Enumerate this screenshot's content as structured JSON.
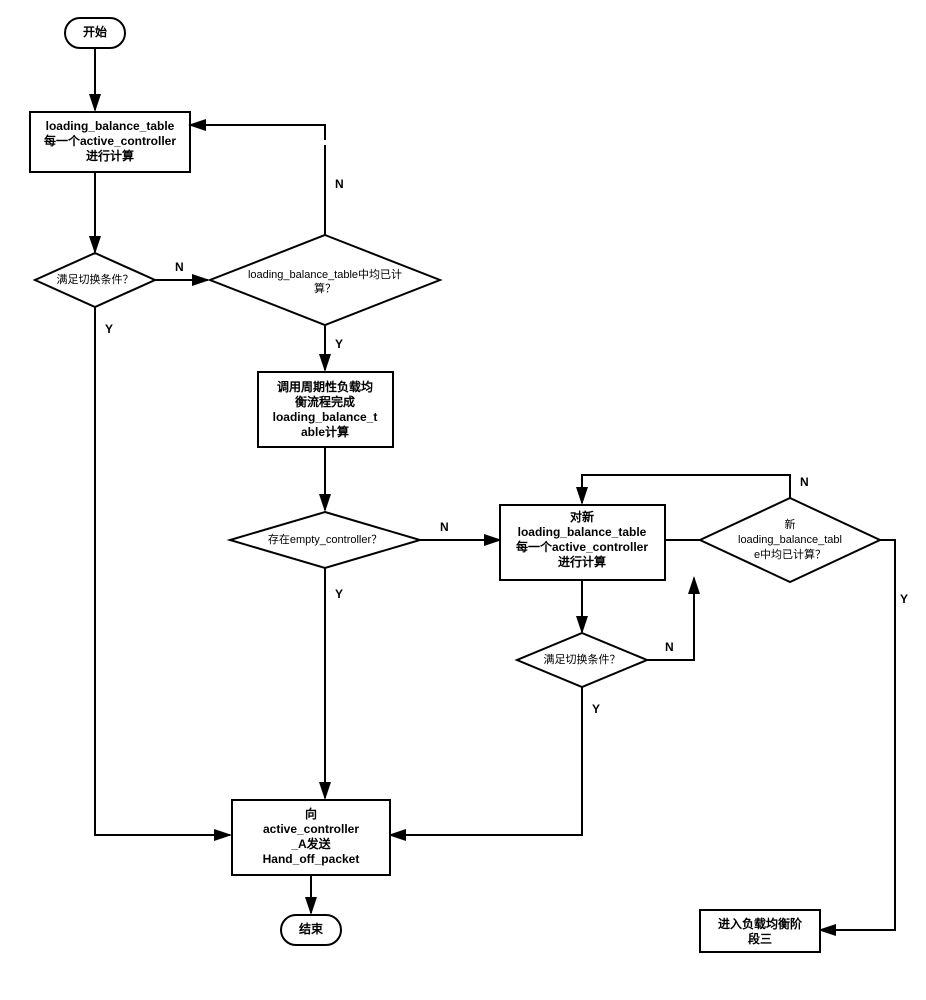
{
  "diagram": {
    "start": "开始",
    "end": "结束",
    "box1_l1": "loading_balance_table",
    "box1_l2": "每一个active_controller",
    "box1_l3": "进行计算",
    "d1": "满足切换条件？",
    "d2_l1": "loading_balance_table中均已计",
    "d2_l2": "算？",
    "box2_l1": "调用周期性负载均",
    "box2_l2": "衡流程完成",
    "box2_l3": "loading_balance_t",
    "box2_l4": "able计算",
    "d3": "存在empty_controller？",
    "box3_l1": "对新",
    "box3_l2": "loading_balance_table",
    "box3_l3": "每一个active_controller",
    "box3_l4": "进行计算",
    "d4": "满足切换条件？",
    "d5_l1": "新",
    "d5_l2": "loading_balance_tabl",
    "d5_l3": "e中均已计算？",
    "box4_l1": "向",
    "box4_l2": "active_controller",
    "box4_l3": "_A发送",
    "box4_l4": "Hand_off_packet",
    "box5_l1": "进入负载均衡阶",
    "box5_l2": "段三",
    "Y": "Y",
    "N": "N"
  }
}
